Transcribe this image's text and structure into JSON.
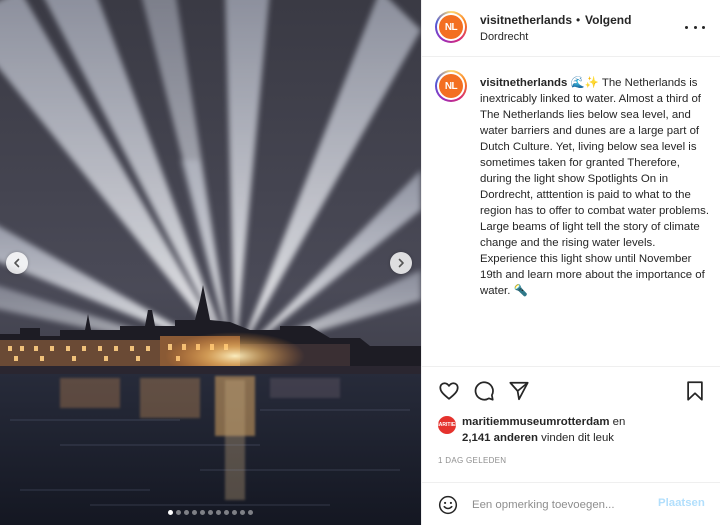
{
  "post": {
    "username": "visitnetherlands",
    "separator": "•",
    "follow_label": "Volgend",
    "location": "Dordrecht",
    "avatar_text": "NL",
    "carousel_total": 11,
    "carousel_active": 1
  },
  "caption": {
    "username": "visitnetherlands",
    "emoji": "🌊✨",
    "text": "The Netherlands is inextricably linked to water. Almost a third of The Netherlands lies below sea level, and water barriers and dunes are a large part of Dutch Culture. Yet, living below sea level is sometimes taken for granted Therefore, during the light show Spotlights On in Dordrecht, atttention is paid to what to the region has to offer to combat water problems. Large beams of light tell the story of climate change and the rising water levels. Experience this light show until November 19th and learn more about the importance of water.",
    "trailing_emoji": "🔦"
  },
  "likes": {
    "avatar_text": "MARITIEM",
    "liker": "maritiemmuseumrotterdam",
    "connector": "en",
    "count_text": "2,141 anderen",
    "suffix": "vinden dit leuk"
  },
  "timestamp": "1 DAG GELEDEN",
  "comment": {
    "placeholder": "Een opmerking toevoegen...",
    "post_label": "Plaatsen"
  },
  "icons": {
    "like": "heart-icon",
    "comment": "comment-icon",
    "share": "send-icon",
    "save": "bookmark-icon",
    "emoji": "emoji-icon",
    "more": "more-icon",
    "prev": "chevron-left-icon",
    "next": "chevron-right-icon"
  },
  "colors": {
    "brand_orange": "#f36f21",
    "post_button_disabled": "#b2dffc",
    "muted_text": "#8e8e8e"
  }
}
